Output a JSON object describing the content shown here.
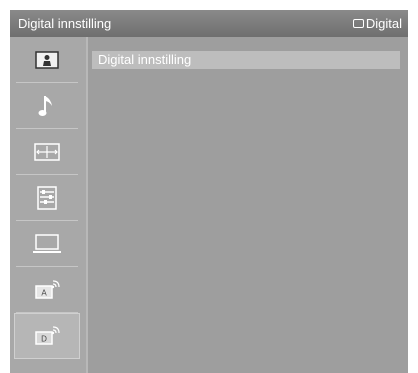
{
  "header": {
    "title": "Digital innstilling",
    "source_label": "Digital",
    "source_icon": "source-rectangle-icon"
  },
  "sidebar": {
    "items": [
      {
        "icon": "picture-icon",
        "selected": false
      },
      {
        "icon": "music-note-icon",
        "selected": false
      },
      {
        "icon": "screen-size-icon",
        "selected": false
      },
      {
        "icon": "settings-list-icon",
        "selected": false
      },
      {
        "icon": "laptop-icon",
        "selected": false
      },
      {
        "icon": "analog-antenna-icon",
        "selected": false
      },
      {
        "icon": "digital-antenna-icon",
        "selected": true
      }
    ]
  },
  "menu": {
    "items": [
      {
        "label": "Digital innstilling"
      }
    ]
  }
}
